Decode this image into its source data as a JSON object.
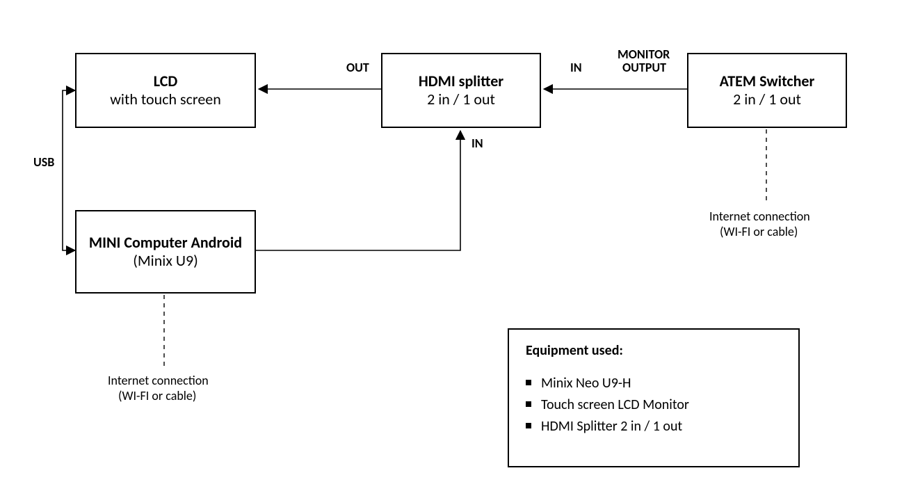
{
  "nodes": {
    "lcd": {
      "title": "LCD",
      "sub": "with touch screen"
    },
    "splitter": {
      "title": "HDMI splitter",
      "sub": "2 in / 1 out"
    },
    "atem": {
      "title": "ATEM Switcher",
      "sub": "2 in / 1 out"
    },
    "mini": {
      "title": "MINI Computer Android",
      "sub": "(Minix U9)"
    }
  },
  "labels": {
    "out": "OUT",
    "in1": "IN",
    "in2": "IN",
    "monitor_out1": "MONITOR",
    "monitor_out2": "OUTPUT",
    "usb": "USB"
  },
  "internet": {
    "line1": "Internet connection",
    "line2": "(WI-FI or cable)"
  },
  "equipment": {
    "header": "Equipment used:",
    "items": [
      "Minix Neo U9-H",
      "Touch screen LCD Monitor",
      "HDMI Splitter 2 in / 1 out"
    ]
  }
}
